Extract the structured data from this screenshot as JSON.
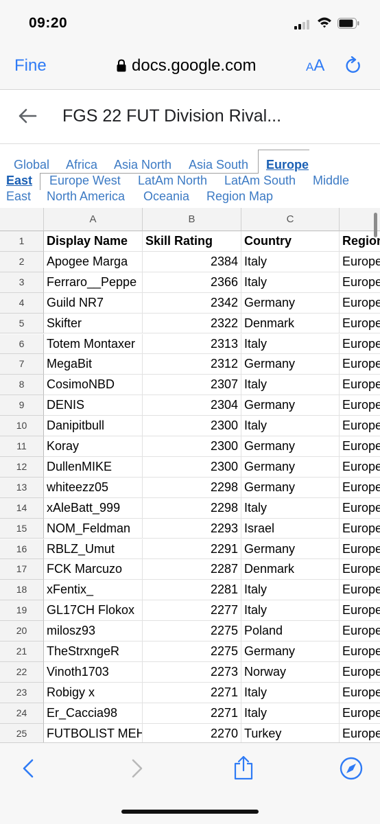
{
  "status": {
    "time": "09:20"
  },
  "browser": {
    "back_label": "Fine",
    "url": "docs.google.com",
    "aa_small": "A",
    "aa_large": "A"
  },
  "doc": {
    "title": "FGS 22 FUT Division Rival..."
  },
  "tabs": [
    {
      "label": "Global",
      "active": false
    },
    {
      "label": "Africa",
      "active": false
    },
    {
      "label": "Asia North",
      "active": false
    },
    {
      "label": "Asia South",
      "active": false
    },
    {
      "label": "Europe",
      "active": true
    },
    {
      "label": "East",
      "active": true
    },
    {
      "label": "Europe West",
      "active": false
    },
    {
      "label": "LatAm North",
      "active": false
    },
    {
      "label": "LatAm South",
      "active": false
    },
    {
      "label": "Middle",
      "active": false
    },
    {
      "label": "East",
      "active": false
    },
    {
      "label": "North America",
      "active": false
    },
    {
      "label": "Oceania",
      "active": false
    },
    {
      "label": "Region Map",
      "active": false
    }
  ],
  "sheet": {
    "columns": [
      "A",
      "B",
      "C",
      ""
    ],
    "header_row": {
      "num": "1",
      "cells": [
        "Display Name",
        "Skill Rating",
        "Country",
        "Region"
      ]
    },
    "rows": [
      {
        "num": "2",
        "name": "Apogee Marga",
        "rating": "2384",
        "country": "Italy",
        "region": "Europe"
      },
      {
        "num": "3",
        "name": "Ferraro__Peppe",
        "rating": "2366",
        "country": "Italy",
        "region": "Europe"
      },
      {
        "num": "4",
        "name": "Guild NR7",
        "rating": "2342",
        "country": "Germany",
        "region": "Europe"
      },
      {
        "num": "5",
        "name": "Skifter",
        "rating": "2322",
        "country": "Denmark",
        "region": "Europe"
      },
      {
        "num": "6",
        "name": "Totem Montaxer",
        "rating": "2313",
        "country": "Italy",
        "region": "Europe"
      },
      {
        "num": "7",
        "name": "MegaBit",
        "rating": "2312",
        "country": "Germany",
        "region": "Europe"
      },
      {
        "num": "8",
        "name": "CosimoNBD",
        "rating": "2307",
        "country": "Italy",
        "region": "Europe"
      },
      {
        "num": "9",
        "name": "DENIS",
        "rating": "2304",
        "country": "Germany",
        "region": "Europe"
      },
      {
        "num": "10",
        "name": "Danipitbull",
        "rating": "2300",
        "country": "Italy",
        "region": "Europe"
      },
      {
        "num": "11",
        "name": "Koray",
        "rating": "2300",
        "country": "Germany",
        "region": "Europe"
      },
      {
        "num": "12",
        "name": "DullenMIKE",
        "rating": "2300",
        "country": "Germany",
        "region": "Europe"
      },
      {
        "num": "13",
        "name": "whiteezz05",
        "rating": "2298",
        "country": "Germany",
        "region": "Europe"
      },
      {
        "num": "14",
        "name": "xAleBatt_999",
        "rating": "2298",
        "country": "Italy",
        "region": "Europe"
      },
      {
        "num": "15",
        "name": "NOM_Feldman",
        "rating": "2293",
        "country": "Israel",
        "region": "Europe"
      },
      {
        "num": "16",
        "name": "RBLZ_Umut",
        "rating": "2291",
        "country": "Germany",
        "region": "Europe"
      },
      {
        "num": "17",
        "name": "FCK Marcuzo",
        "rating": "2287",
        "country": "Denmark",
        "region": "Europe"
      },
      {
        "num": "18",
        "name": "xFentix_",
        "rating": "2281",
        "country": "Italy",
        "region": "Europe"
      },
      {
        "num": "19",
        "name": "GL17CH Flokox",
        "rating": "2277",
        "country": "Italy",
        "region": "Europe"
      },
      {
        "num": "20",
        "name": "milosz93",
        "rating": "2275",
        "country": "Poland",
        "region": "Europe"
      },
      {
        "num": "21",
        "name": "TheStrxngeR",
        "rating": "2275",
        "country": "Germany",
        "region": "Europe"
      },
      {
        "num": "22",
        "name": "Vinoth1703",
        "rating": "2273",
        "country": "Norway",
        "region": "Europe"
      },
      {
        "num": "23",
        "name": "Robigy x",
        "rating": "2271",
        "country": "Italy",
        "region": "Europe"
      },
      {
        "num": "24",
        "name": "Er_Caccia98",
        "rating": "2271",
        "country": "Italy",
        "region": "Europe"
      },
      {
        "num": "25",
        "name": "FUTBOLIST MEHMET",
        "rating": "2270",
        "country": "Turkey",
        "region": "Europe"
      }
    ]
  },
  "colors": {
    "ios_blue": "#2f7bf5",
    "tab_blue": "#3c7ac4",
    "header_gray": "#f3f3f3"
  },
  "icons": [
    "lock-icon",
    "reload-icon",
    "back-arrow-icon",
    "chevron-left-icon",
    "chevron-right-icon",
    "share-icon",
    "compass-icon"
  ]
}
